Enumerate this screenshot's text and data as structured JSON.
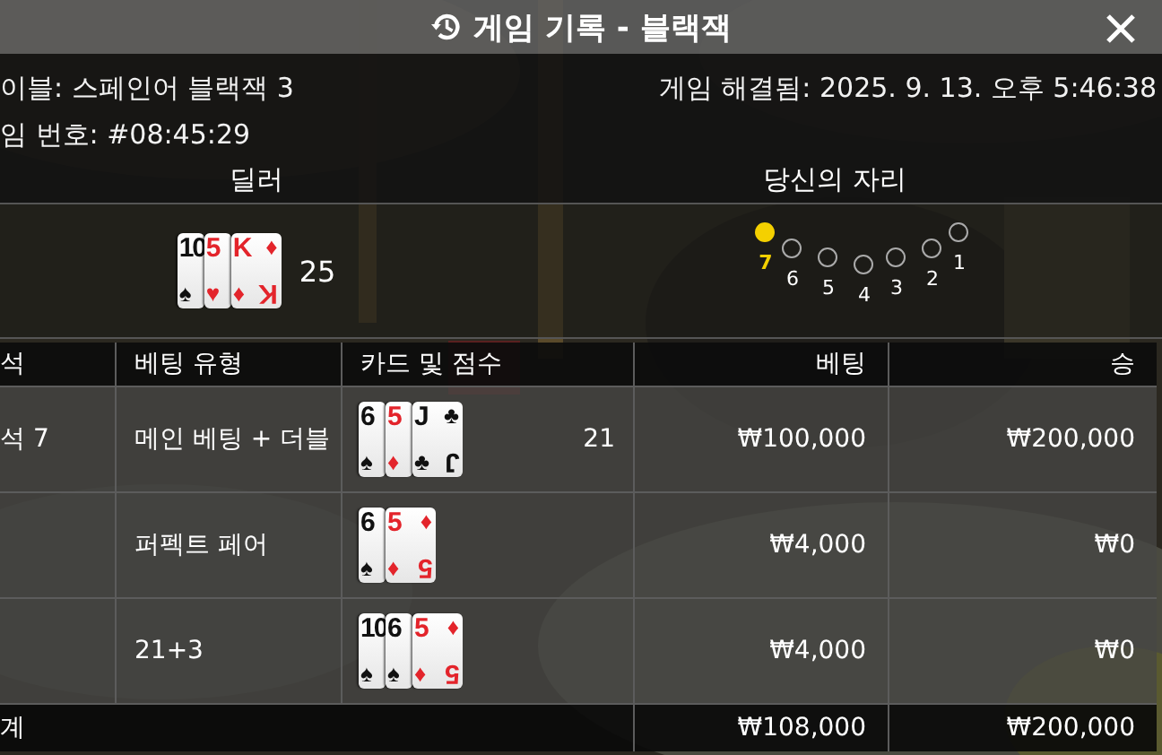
{
  "header": {
    "title": "게임 기록 - 블랙잭"
  },
  "info": {
    "table_name": "이블: 스페인어 블랙잭 3",
    "round_id": "임 번호: #08:45:29",
    "resolved": "게임 해결됨: 2025. 9. 13. 오후 5:46:38"
  },
  "dealer": {
    "heading": "딜러",
    "cards": [
      {
        "rank": "10",
        "suit": "♠"
      },
      {
        "rank": "5",
        "suit": "♥"
      },
      {
        "rank": "K",
        "suit": "♦",
        "suit_top": "♦",
        "rank_flipped": "K"
      }
    ],
    "score": "25"
  },
  "seats": {
    "heading": "당신의 자리",
    "items": [
      {
        "label": "7",
        "selected": true
      },
      {
        "label": "6",
        "selected": false
      },
      {
        "label": "5",
        "selected": false
      },
      {
        "label": "4",
        "selected": false
      },
      {
        "label": "3",
        "selected": false
      },
      {
        "label": "2",
        "selected": false
      },
      {
        "label": "1",
        "selected": false
      }
    ]
  },
  "table": {
    "columns": [
      "석",
      "베팅 유형",
      "카드 및 점수",
      "베팅",
      "승"
    ],
    "rows": [
      {
        "seat": "석 7",
        "bet_type": "메인 베팅 + 더블",
        "cards": [
          {
            "rank": "6",
            "suit": "♠"
          },
          {
            "rank": "5",
            "suit": "♦"
          },
          {
            "rank": "J",
            "suit": "♣",
            "suit_top": "♣",
            "rank_flipped": "J"
          }
        ],
        "score": "21",
        "bet": "₩100,000",
        "win": "₩200,000"
      },
      {
        "bet_type": "퍼펙트 페어",
        "cards": [
          {
            "rank": "6",
            "suit": "♠"
          },
          {
            "rank": "5",
            "suit": "♦",
            "suit_top": "♦",
            "rank_flipped": "5"
          }
        ],
        "bet": "₩4,000",
        "win": "₩0"
      },
      {
        "bet_type": "21+3",
        "cards": [
          {
            "rank": "10",
            "suit": "♠"
          },
          {
            "rank": "6",
            "suit": "♠"
          },
          {
            "rank": "5",
            "suit": "♦",
            "suit_top": "♦",
            "rank_flipped": "5"
          }
        ],
        "bet": "₩4,000",
        "win": "₩0"
      }
    ],
    "total": {
      "label": "계",
      "bet": "₩108,000",
      "win": "₩200,000"
    }
  }
}
